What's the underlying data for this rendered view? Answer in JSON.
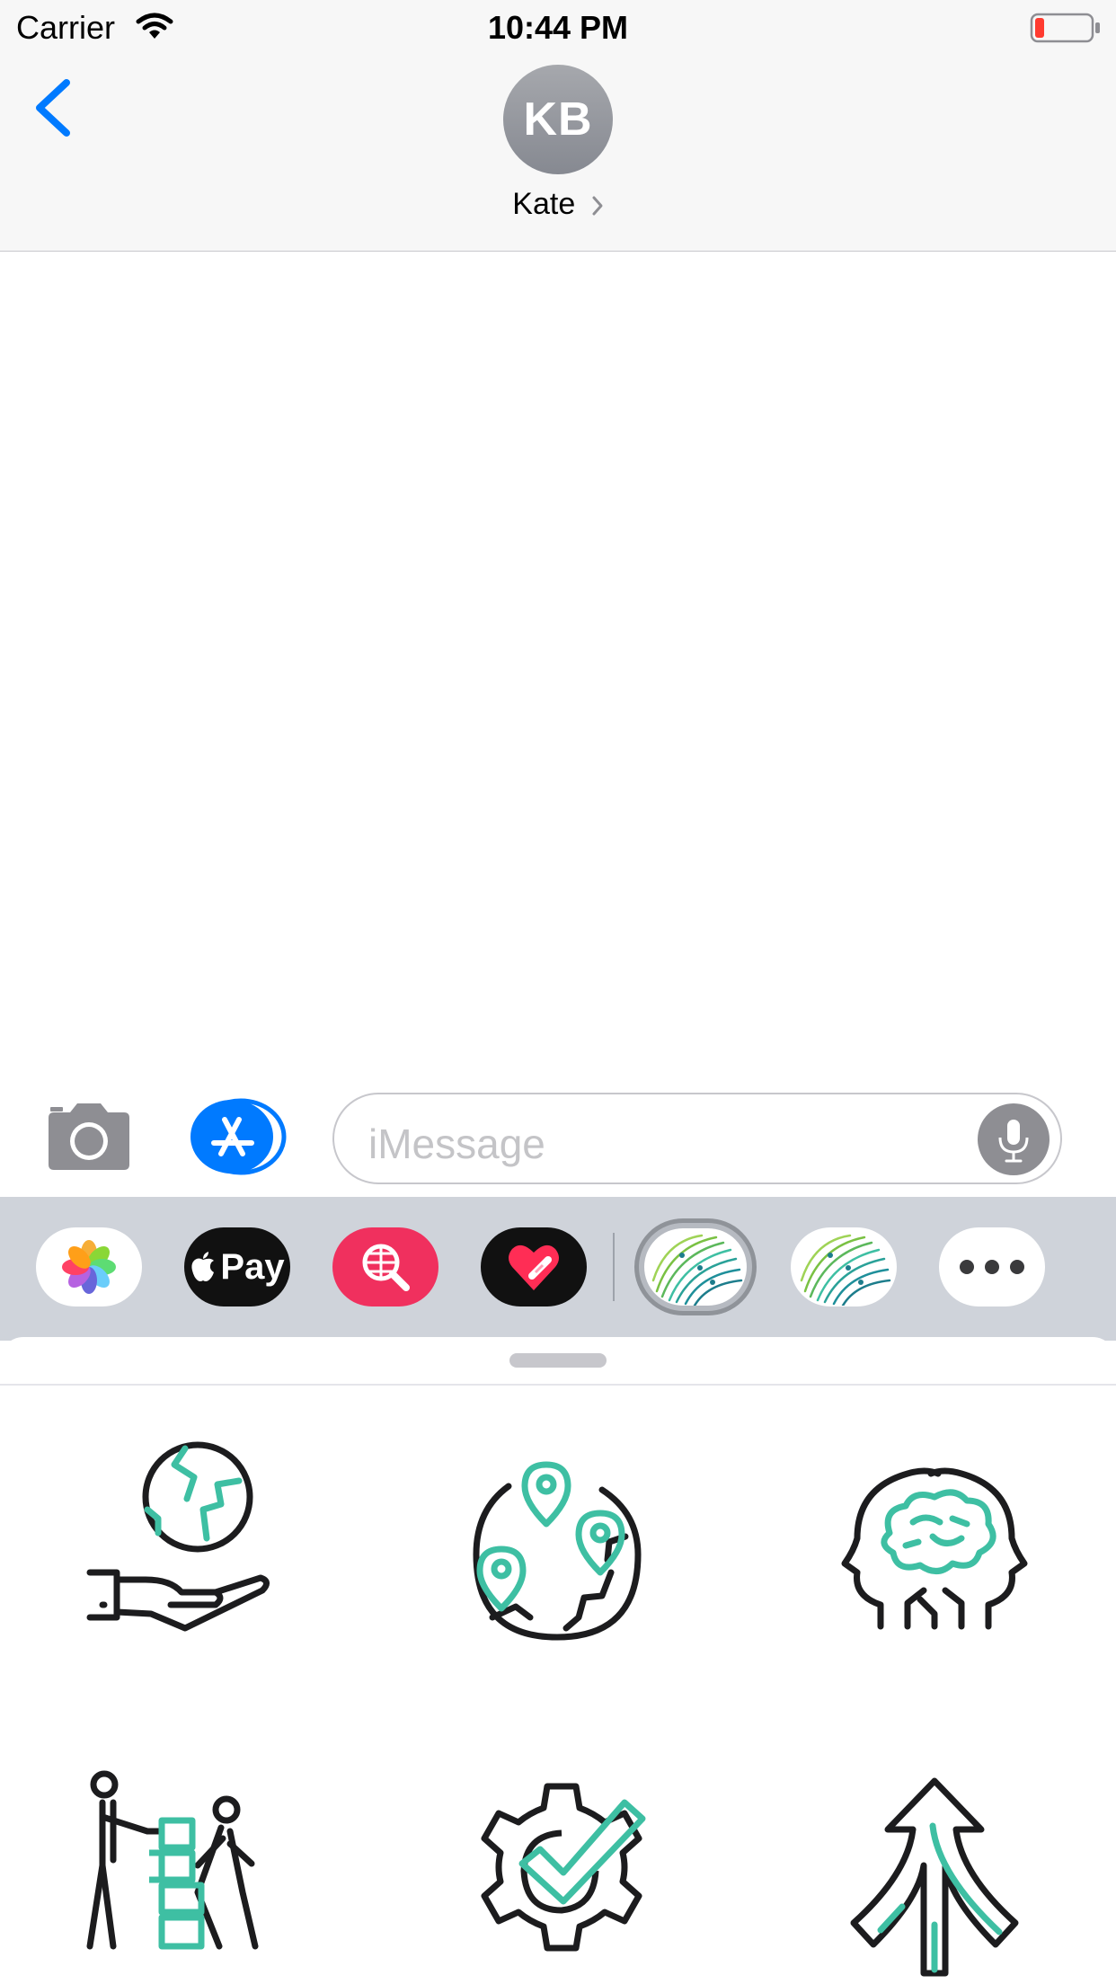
{
  "status_bar": {
    "carrier": "Carrier",
    "time": "10:44 PM",
    "battery": "low"
  },
  "header": {
    "avatar_initials": "KB",
    "contact_name": "Kate"
  },
  "compose": {
    "placeholder": "iMessage"
  },
  "app_drawer": {
    "apps": [
      {
        "name": "Photos",
        "icon": "photos-icon"
      },
      {
        "name": "Apple Pay",
        "label": "Pay",
        "icon": "apple-pay-icon"
      },
      {
        "name": "Web search",
        "icon": "globe-search-icon"
      },
      {
        "name": "Digital Touch",
        "icon": "heart-icon"
      },
      {
        "name": "Sticker pack",
        "icon": "fingerprint-circuit-icon",
        "selected": true
      },
      {
        "name": "Sticker pack",
        "icon": "fingerprint-circuit-icon"
      },
      {
        "name": "More",
        "icon": "more-icon"
      }
    ]
  },
  "stickers": [
    {
      "icon": "hand-holding-globe-icon"
    },
    {
      "icon": "globe-location-pins-icon"
    },
    {
      "icon": "two-heads-brain-icon"
    },
    {
      "icon": "people-moving-boxes-icon"
    },
    {
      "icon": "gear-checkmark-icon"
    },
    {
      "icon": "merging-arrows-up-icon"
    }
  ],
  "colors": {
    "accent": "#007aff",
    "sticker_teal": "#3ebfa3",
    "sticker_line": "#1c1c1e"
  }
}
